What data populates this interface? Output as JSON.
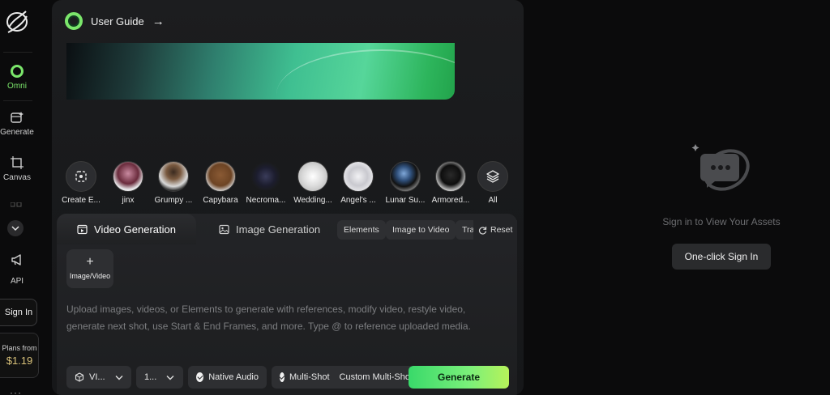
{
  "sidebar": {
    "items": [
      {
        "label": "Omni",
        "icon": "omni-ring-icon",
        "active": true
      },
      {
        "label": "Generate",
        "icon": "generate-icon"
      },
      {
        "label": "Canvas",
        "icon": "canvas-icon"
      },
      {
        "label": "API",
        "icon": "megaphone-icon"
      }
    ],
    "sign_in": "Sign In",
    "plans_label": "Plans from",
    "plans_price": "$1.19",
    "more": "···"
  },
  "guide": {
    "label": "User Guide",
    "arrow": "→"
  },
  "presets": [
    {
      "label": "Create E...",
      "icon": "create-element-icon"
    },
    {
      "label": "jinx"
    },
    {
      "label": "Grumpy ..."
    },
    {
      "label": "Capybara"
    },
    {
      "label": "Necroma..."
    },
    {
      "label": "Wedding..."
    },
    {
      "label": "Angel's ..."
    },
    {
      "label": "Lunar Su..."
    },
    {
      "label": "Armored..."
    },
    {
      "label": "All",
      "icon": "layers-icon"
    }
  ],
  "tabs": {
    "video": "Video Generation",
    "image": "Image Generation"
  },
  "chips": [
    "Elements",
    "Image to Video",
    "Tra"
  ],
  "reset": "Reset",
  "upload_label": "Image/Video",
  "upload_plus": "+",
  "prompt_placeholder": "Upload images, videos, or Elements to generate with references, modify video, restyle video, generate next shot, use Start & End Frames, and more. Type @ to reference uploaded media.",
  "bottom": {
    "model": "VI...",
    "ratio": "1...",
    "native_audio": "Native Audio",
    "multi_shot": "Multi-Shot",
    "custom_multi": "Custom Multi-Sho",
    "generate": "Generate"
  },
  "assets": {
    "message": "Sign in to View Your Assets",
    "button": "One-click Sign In"
  },
  "colors": {
    "accent": "#7be66b",
    "generate_start": "#39d96a",
    "generate_end": "#b7f25a",
    "price": "#d9c27a"
  }
}
